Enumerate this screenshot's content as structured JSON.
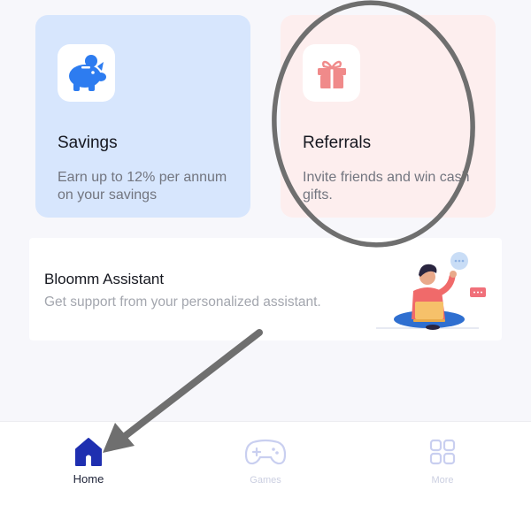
{
  "cards": [
    {
      "title": "Savings",
      "description": "Earn up to 12% per annum on your savings",
      "icon": "piggy-bank-icon",
      "background": "#d7e6fd",
      "icon_color": "#2d7cf0"
    },
    {
      "title": "Referrals",
      "description": "Invite friends and win cash gifts.",
      "icon": "gift-icon",
      "background": "#fdeeee",
      "icon_color": "#f08a8a"
    }
  ],
  "assistant": {
    "title": "Bloomm Assistant",
    "description": "Get support from your personalized assistant.",
    "illustration": "person-with-laptop-illustration"
  },
  "bottom_nav": {
    "items": [
      {
        "label": "Home",
        "icon": "home-icon",
        "active": true,
        "color": "#1f2fb0"
      },
      {
        "label": "Games",
        "icon": "gamepad-icon",
        "active": false,
        "color": "#c9cff0"
      },
      {
        "label": "More",
        "icon": "grid-icon",
        "active": false,
        "color": "#c9cff0"
      }
    ]
  },
  "annotations": {
    "highlight_target": "Referrals",
    "arrow_target": "Home",
    "stroke_color": "#6f6f6f"
  }
}
